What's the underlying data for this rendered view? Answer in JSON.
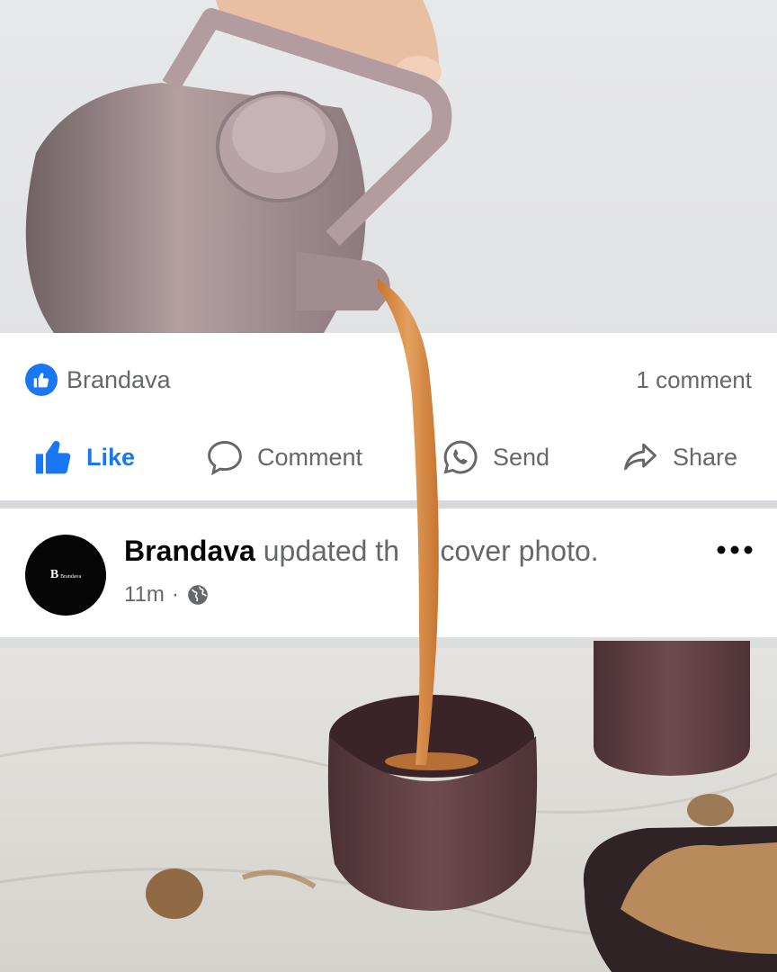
{
  "post": {
    "reactions": {
      "name": "Brandava"
    },
    "comments": {
      "count_label": "1 comment"
    },
    "actions": {
      "like": "Like",
      "comment": "Comment",
      "send": "Send",
      "share": "Share"
    },
    "story": {
      "page_name": "Brandava",
      "text_visible": "updated th",
      "text_after": "r cover photo.",
      "time": "11m",
      "separator": "·",
      "privacy_icon": "globe-icon",
      "more_icon": "more-options-icon"
    },
    "avatar": {
      "logo_text": "B",
      "logo_small": "Brandava"
    }
  },
  "colors": {
    "facebook_blue": "#1877f2",
    "secondary_text": "#65676b",
    "primary_text": "#050505",
    "divider": "#d7d8dc",
    "tea": "#d98a3c"
  }
}
